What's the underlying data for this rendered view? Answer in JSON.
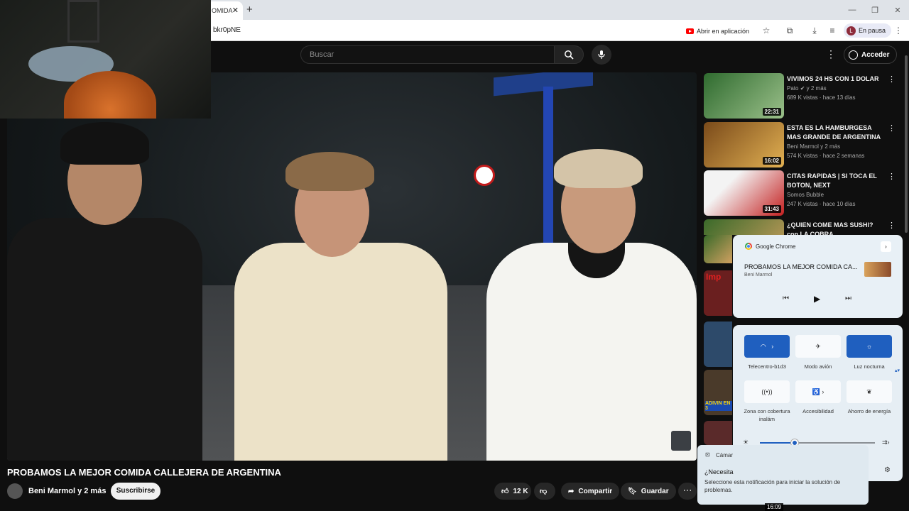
{
  "browser": {
    "tab_text": "OMIDA",
    "url_fragment": "bkr0pNE",
    "open_app_label": "Abrir en aplicación",
    "profile_initial": "L",
    "profile_status": "En pausa"
  },
  "youtube": {
    "search_placeholder": "Buscar",
    "sign_in_label": "Acceder"
  },
  "video": {
    "title": "PROBAMOS LA MEJOR COMIDA CALLEJERA DE ARGENTINA",
    "channel": "Beni Marmol y 2 más",
    "subscribe_label": "Suscribirse",
    "likes": "12 K",
    "share_label": "Compartir",
    "save_label": "Guardar"
  },
  "recommendations": [
    {
      "title": "VIVIMOS 24 HS CON 1 DOLAR",
      "channel": "Pato",
      "channel_suffix": "y 2 más",
      "meta": "689 K vistas · hace 13 días",
      "duration": "22:31",
      "thumb_color": "#3a7d3a"
    },
    {
      "title": "ESTA ES LA HAMBURGESA MAS GRANDE DE ARGENTINA",
      "channel": "Beni Marmol y 2 más",
      "meta": "574 K vistas · hace 2 semanas",
      "duration": "16:02",
      "thumb_color": "#c98a2e"
    },
    {
      "title": "CITAS RAPIDAS | SI TOCA EL BOTON, NEXT",
      "channel": "Somos Bubble",
      "meta": "247 K vistas · hace 10 días",
      "duration": "31:43",
      "thumb_color": "#b52020"
    },
    {
      "title": "¿QUIEN COME MAS SUSHI? con LA COBRA",
      "duration": "",
      "thumb_color": "#4a7a2a"
    }
  ],
  "side_thumbs_partial": [
    {
      "thumb_color": "#6a1f1f",
      "caption": "Imp"
    },
    {
      "thumb_color": "#2d4a6a",
      "caption": ""
    },
    {
      "thumb_color": "#4a3a2a",
      "caption": "ADIVIN EN 3"
    },
    {
      "thumb_color": "#5a2a2a",
      "caption": ""
    }
  ],
  "media_flyout": {
    "app": "Google Chrome",
    "title": "PROBAMOS LA MEJOR COMIDA CA...",
    "artist": "Beni Marmol"
  },
  "quick_settings": {
    "tiles": [
      {
        "label": "Telecentro-b1d3",
        "on": true
      },
      {
        "label": "Modo avión",
        "on": false
      },
      {
        "label": "Luz nocturna",
        "on": true
      },
      {
        "label": "Zona con cobertura inalám",
        "on": false
      },
      {
        "label": "Accesibilidad",
        "on": false
      },
      {
        "label": "Ahorro de energía",
        "on": false
      }
    ],
    "brightness_fraction": 0.3
  },
  "notification": {
    "app": "Cámar",
    "question": "¿Necesita",
    "body": "Seleccione esta notificación para iniciar la solución de problemas."
  },
  "bottom_duration": "16:09"
}
